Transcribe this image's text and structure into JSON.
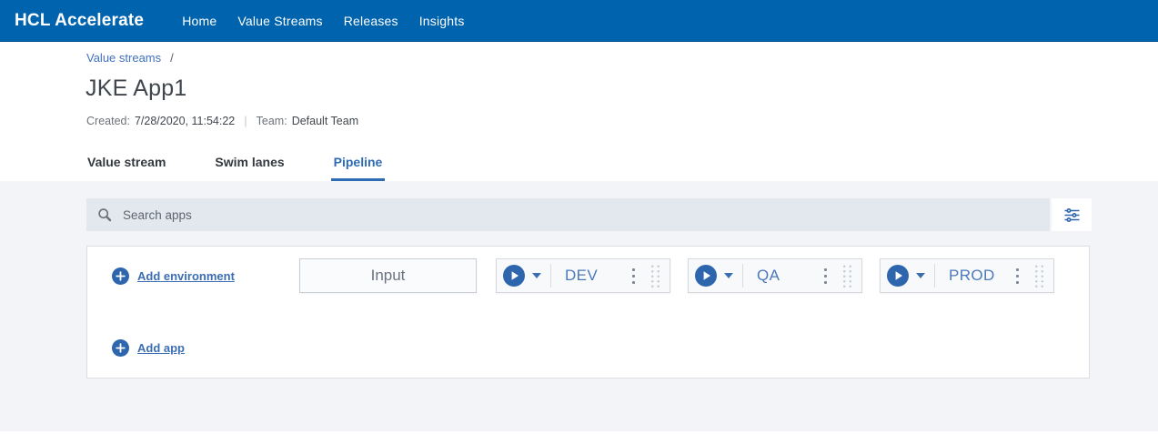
{
  "header": {
    "logo": "HCL Accelerate",
    "nav_items": [
      {
        "label": "Home"
      },
      {
        "label": "Value Streams"
      },
      {
        "label": "Releases"
      },
      {
        "label": "Insights"
      }
    ]
  },
  "breadcrumb": {
    "value_streams": "Value streams",
    "separator": "/"
  },
  "page_header": {
    "title": "JKE App1",
    "created_label": "Created:",
    "created_value": "7/28/2020, 11:54:22",
    "divider": "|",
    "team_label": "Team:",
    "team_value": "Default Team"
  },
  "tabs": {
    "value_stream": "Value stream",
    "swim_lanes": "Swim lanes",
    "pipeline": "Pipeline",
    "active_tab": "Pipeline"
  },
  "toolbar": {
    "search_placeholder": "Search apps"
  },
  "pipeline": {
    "add_environment_label": "Add environment",
    "add_app_label": "Add app",
    "input_box_label": "Input",
    "environments": [
      {
        "name": "DEV"
      },
      {
        "name": "QA"
      },
      {
        "name": "PROD"
      }
    ]
  },
  "icons": {
    "search": "search-icon",
    "filter": "settings-adjust-icon",
    "add": "plus-circle-icon",
    "play": "play-circle-icon",
    "caret": "chevron-down-icon",
    "overflow": "kebab-menu-icon",
    "drag": "drag-handle-icon"
  },
  "colors": {
    "header_bg": "#0063ae",
    "link_blue": "#4171be",
    "active_tab_blue": "#2d6bb4",
    "play_button_blue": "#2e66ae",
    "env_name_blue": "#4b79ba",
    "page_bg_gray": "#f3f4f8",
    "search_bg": "#e3e8ef"
  }
}
